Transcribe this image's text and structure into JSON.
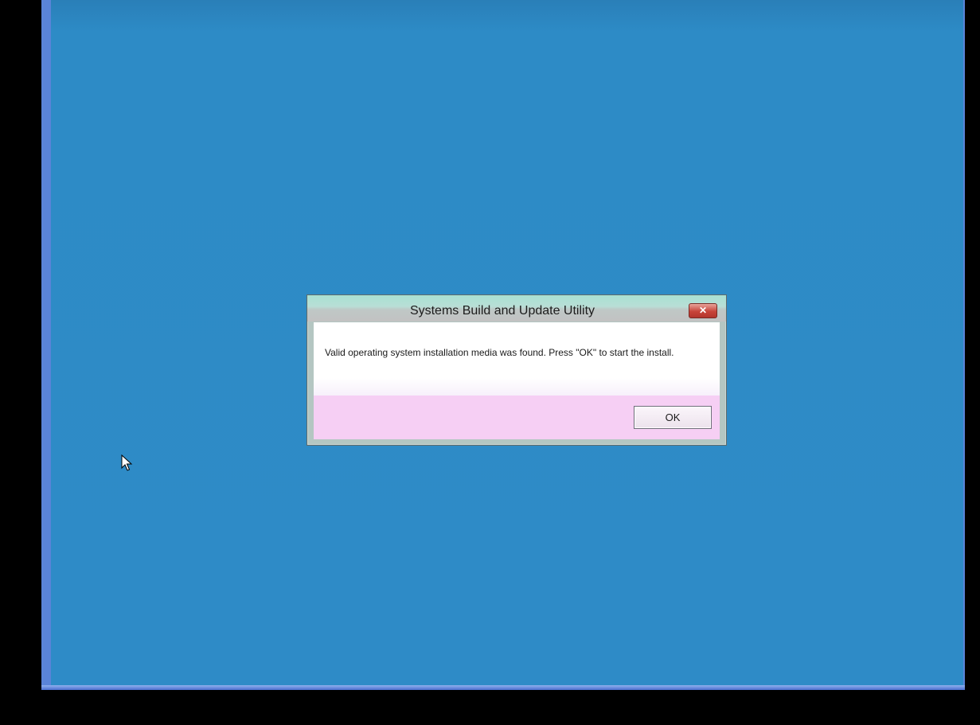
{
  "dialog": {
    "title": "Systems Build and Update Utility",
    "close_glyph": "✕",
    "message": "Valid operating system installation media was found.  Press \"OK\" to start the install.",
    "ok_label": "OK"
  },
  "icons": {
    "close": "close-icon",
    "cursor": "mouse-pointer-icon"
  },
  "colors": {
    "desktop": "#2e8bc7",
    "close_button": "#c7443a",
    "footer": "#f6cff4"
  }
}
